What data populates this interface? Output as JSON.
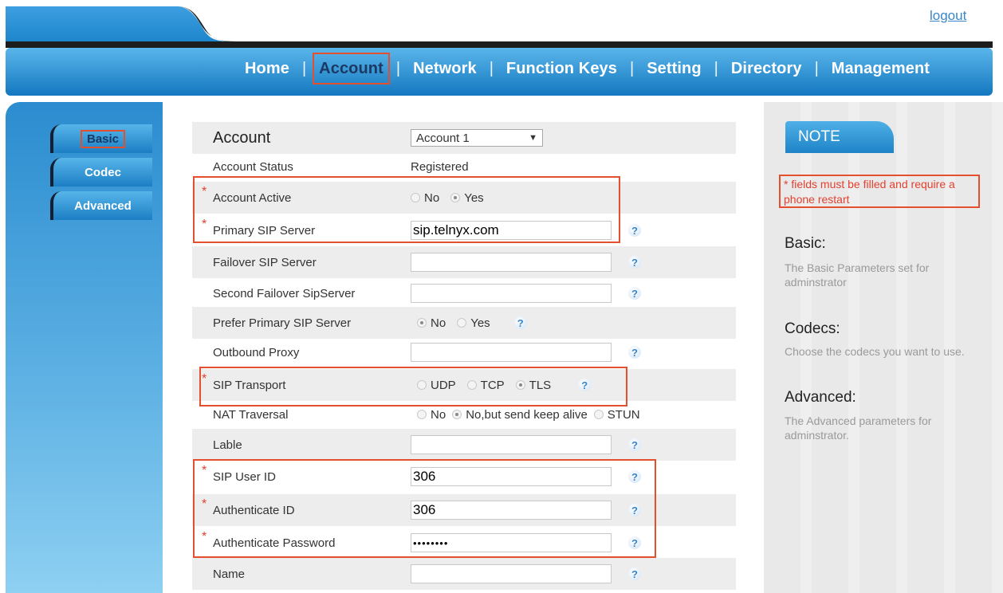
{
  "header": {
    "logout": "logout",
    "nav": [
      {
        "label": "Home",
        "active": false
      },
      {
        "label": "Account",
        "active": true
      },
      {
        "label": "Network",
        "active": false
      },
      {
        "label": "Function Keys",
        "active": false
      },
      {
        "label": "Setting",
        "active": false
      },
      {
        "label": "Directory",
        "active": false
      },
      {
        "label": "Management",
        "active": false
      }
    ]
  },
  "sidebar": {
    "items": [
      {
        "label": "Basic",
        "active": true
      },
      {
        "label": "Codec",
        "active": false
      },
      {
        "label": "Advanced",
        "active": false
      }
    ]
  },
  "form": {
    "title": "Account",
    "account_select": "Account 1",
    "required_mark": "*",
    "help_glyph": "?",
    "rows": {
      "account_status": {
        "label": "Account Status",
        "value": "Registered"
      },
      "account_active": {
        "label": "Account Active",
        "options": [
          "No",
          "Yes"
        ],
        "selected": "Yes"
      },
      "primary_sip_server": {
        "label": "Primary SIP Server",
        "value": "sip.telnyx.com"
      },
      "failover_sip_server": {
        "label": "Failover SIP Server",
        "value": ""
      },
      "second_failover": {
        "label": "Second Failover SipServer",
        "value": ""
      },
      "prefer_primary": {
        "label": "Prefer Primary SIP Server",
        "options": [
          "No",
          "Yes"
        ],
        "selected": "No"
      },
      "outbound_proxy": {
        "label": "Outbound Proxy",
        "value": ""
      },
      "sip_transport": {
        "label": "SIP Transport",
        "options": [
          "UDP",
          "TCP",
          "TLS"
        ],
        "selected": "TLS"
      },
      "nat_traversal": {
        "label": "NAT Traversal",
        "options": [
          "No",
          "No,but send keep alive",
          "STUN"
        ],
        "selected": "No,but send keep alive"
      },
      "lable": {
        "label": "Lable",
        "value": ""
      },
      "sip_user_id": {
        "label": "SIP User ID",
        "value": "306"
      },
      "authenticate_id": {
        "label": "Authenticate ID",
        "value": "306"
      },
      "authenticate_password": {
        "label": "Authenticate Password",
        "value": "••••••••"
      },
      "name": {
        "label": "Name",
        "value": ""
      }
    }
  },
  "note": {
    "tab": "NOTE",
    "warning": "* fields must be filled and require a phone restart",
    "sections": [
      {
        "heading": "Basic:",
        "text": "The Basic Parameters set for adminstrator"
      },
      {
        "heading": "Codecs:",
        "text": "Choose the codecs you want to use."
      },
      {
        "heading": "Advanced:",
        "text": "The Advanced parameters for adminstrator."
      }
    ]
  },
  "colors": {
    "highlight": "#e4502e",
    "nav_blue": "#1e88d0",
    "required": "#e3402f",
    "link": "#3a86c8"
  }
}
